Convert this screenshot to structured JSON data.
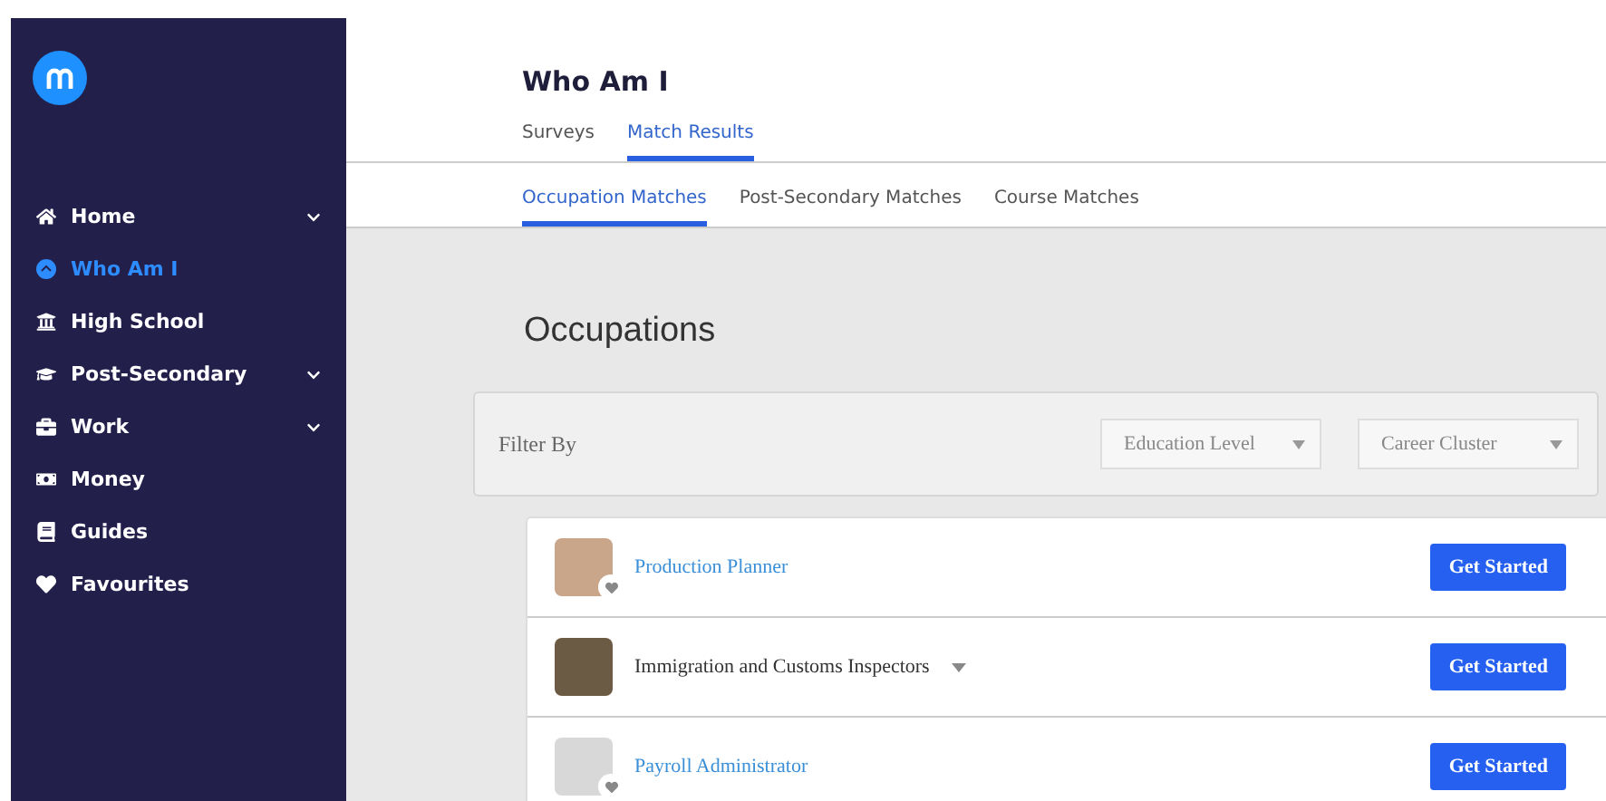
{
  "sidebar": {
    "items": [
      {
        "label": "Home",
        "selected": false,
        "expandable": true
      },
      {
        "label": "Who Am I",
        "selected": true,
        "expandable": false
      },
      {
        "label": "High School",
        "selected": false,
        "expandable": false
      },
      {
        "label": "Post-Secondary",
        "selected": false,
        "expandable": true
      },
      {
        "label": "Work",
        "selected": false,
        "expandable": true
      },
      {
        "label": "Money",
        "selected": false,
        "expandable": false
      },
      {
        "label": "Guides",
        "selected": false,
        "expandable": false
      },
      {
        "label": "Favourites",
        "selected": false,
        "expandable": false
      }
    ]
  },
  "page": {
    "title": "Who Am I",
    "tabs": [
      {
        "label": "Surveys",
        "selected": false
      },
      {
        "label": "Match Results",
        "selected": true
      }
    ],
    "subtabs": [
      {
        "label": "Occupation Matches",
        "selected": true
      },
      {
        "label": "Post-Secondary Matches",
        "selected": false
      },
      {
        "label": "Course Matches",
        "selected": false
      }
    ],
    "heading": "Occupations",
    "filter": {
      "label": "Filter By",
      "selects": [
        {
          "placeholder": "Education Level"
        },
        {
          "placeholder": "Career Cluster"
        }
      ]
    },
    "occupations": [
      {
        "name": "Production Planner",
        "kind": "link",
        "button": "Get Started"
      },
      {
        "name": "Immigration and Customs Inspectors",
        "kind": "expandable",
        "button": "Get Started"
      },
      {
        "name": "Payroll Administrator",
        "kind": "link",
        "button": "Get Started"
      }
    ]
  }
}
